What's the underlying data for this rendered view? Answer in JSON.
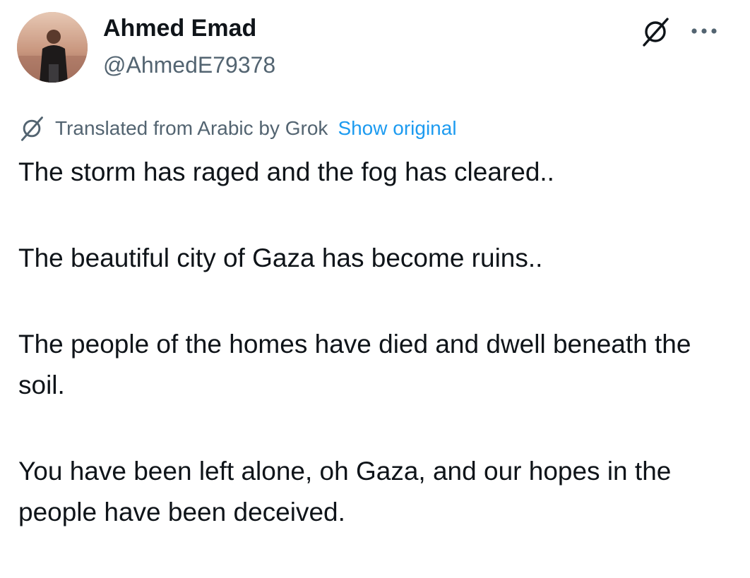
{
  "author": {
    "name": "Ahmed Emad",
    "handle": "@AhmedE79378"
  },
  "icons": {
    "grok": "grok-icon",
    "more": "more-horizontal-icon",
    "avatar": "profile-photo"
  },
  "translation": {
    "label": "Translated from Arabic by Grok",
    "show_original": "Show original"
  },
  "post": {
    "paragraphs": [
      "The storm has raged and the fog has cleared..",
      "The beautiful city of Gaza has become ruins..",
      "The people of the homes have died and dwell beneath the soil.",
      "You have been left alone, oh Gaza, and our hopes in the people have been deceived."
    ]
  },
  "colors": {
    "text": "#0f1419",
    "secondary_text": "#536471",
    "link": "#1d9bf0",
    "background": "#ffffff"
  }
}
